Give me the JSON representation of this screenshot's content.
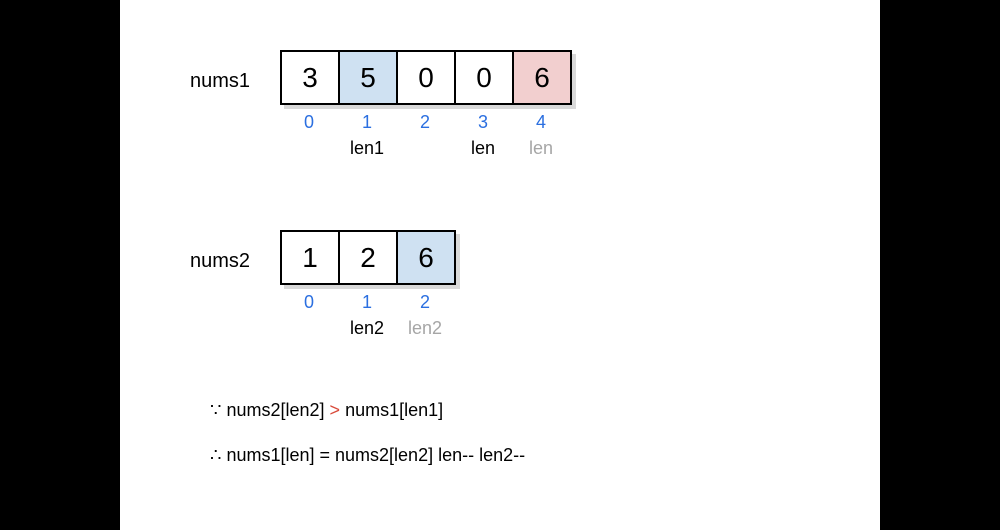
{
  "labels": {
    "nums1": "nums1",
    "nums2": "nums2"
  },
  "nums1": {
    "cells": [
      "3",
      "5",
      "0",
      "0",
      "6"
    ],
    "indices": [
      "0",
      "1",
      "2",
      "3",
      "4"
    ],
    "pointers": [
      "",
      "len1",
      "",
      "len",
      "len"
    ]
  },
  "nums2": {
    "cells": [
      "1",
      "2",
      "6"
    ],
    "indices": [
      "0",
      "1",
      "2"
    ],
    "pointers": [
      "",
      "len2",
      "len2"
    ]
  },
  "logic": {
    "cond_prefix": "∵ nums2[len2]",
    "cond_op": ">",
    "cond_suffix": "nums1[len1]",
    "result": "∴ nums1[len] = nums2[len2]   len-- len2--"
  }
}
